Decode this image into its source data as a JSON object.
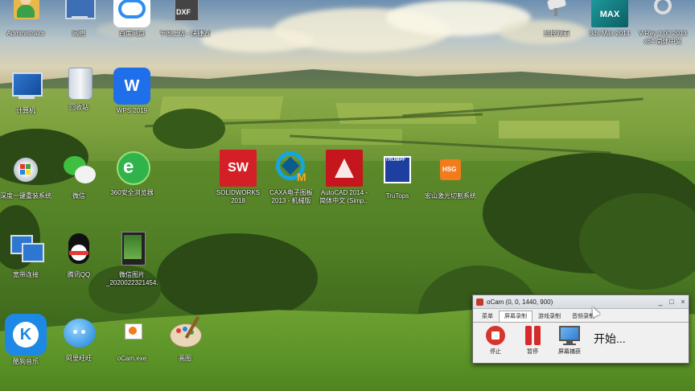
{
  "desktop": {
    "icons": [
      {
        "id": "administrator",
        "label": "Administrator",
        "icon": "user-folder-icon"
      },
      {
        "id": "network",
        "label": "网络",
        "icon": "network-icon"
      },
      {
        "id": "baidu",
        "label": "百度网盘",
        "icon": "baidu-netdisk-icon"
      },
      {
        "id": "dxf",
        "label": "千图上仿 - 快捷方式",
        "icon": "dxf-file-icon"
      },
      {
        "id": "computer",
        "label": "计算机",
        "icon": "computer-icon"
      },
      {
        "id": "recycle",
        "label": "回收站",
        "icon": "recycle-bin-icon"
      },
      {
        "id": "wps",
        "label": "WPS 2019",
        "icon": "wps-icon"
      },
      {
        "id": "onekey",
        "label": "深度一键重装系统",
        "icon": "windows-icon"
      },
      {
        "id": "wechat",
        "label": "微信",
        "icon": "wechat-icon"
      },
      {
        "id": "browser360",
        "label": "360安全浏览器",
        "icon": "360-browser-icon"
      },
      {
        "id": "solidworks",
        "label": "SOLIDWORKS 2018",
        "icon": "solidworks-icon",
        "badge": "2018"
      },
      {
        "id": "caxa",
        "label": "CAXA电子图板 2013 - 机械版",
        "icon": "caxa-icon"
      },
      {
        "id": "autocad",
        "label": "AutoCAD 2014 - 简体中文 (Simp...",
        "icon": "autocad-icon"
      },
      {
        "id": "trutops",
        "label": "TruTops",
        "icon": "trumpf-icon",
        "badge": "TRUMPF"
      },
      {
        "id": "hsg",
        "label": "宏山激光切割系统",
        "icon": "hsg-icon",
        "badge": "HSG"
      },
      {
        "id": "lan",
        "label": "宽带连接",
        "icon": "lan-icon"
      },
      {
        "id": "qq",
        "label": "腾讯QQ",
        "icon": "qq-icon"
      },
      {
        "id": "photo",
        "label": "微信图片_2020022321454...",
        "icon": "image-file-icon"
      },
      {
        "id": "kugou",
        "label": "酷狗音乐",
        "icon": "kugou-icon",
        "badge": "K"
      },
      {
        "id": "birdsnap",
        "label": "阿里旺旺",
        "icon": "bird-icon"
      },
      {
        "id": "ocam",
        "label": "oCam.exe",
        "icon": "ocam-shortcut-icon"
      },
      {
        "id": "paint",
        "label": "画图",
        "icon": "paint-palette-icon"
      },
      {
        "id": "cameraview",
        "label": "监控观看",
        "icon": "camera-icon"
      },
      {
        "id": "max",
        "label": "3ds Max 2014",
        "icon": "3dsmax-icon",
        "badge": "MAX"
      },
      {
        "id": "vray",
        "label": "V-Ray 3.00 2013 x64 简体中文",
        "icon": "vray-icon"
      }
    ]
  },
  "ocam": {
    "title": "oCam (0, 0, 1440, 900)",
    "controls": {
      "minimize": "_",
      "maximize": "□",
      "close": "×"
    },
    "tabs": [
      "菜单",
      "屏幕录制",
      "游戏录制",
      "音频录制"
    ],
    "active_tab": "屏幕录制",
    "buttons": [
      {
        "id": "stop",
        "label": "停止",
        "icon": "stop-icon"
      },
      {
        "id": "pause",
        "label": "暂停",
        "icon": "pause-icon"
      },
      {
        "id": "screen",
        "label": "屏幕捕获",
        "icon": "monitor-capture-icon"
      }
    ],
    "status": "开始..."
  },
  "colors": {
    "stop_red": "#d9342b",
    "pause_red": "#d42a2a",
    "monitor_blue": "#2f7fd3",
    "kugou_blue": "#1e88e5",
    "wps_blue": "#1f6fea",
    "solidworks_red": "#d41f26",
    "autocad_red": "#c4161c",
    "hsg_orange": "#f27b1c"
  }
}
